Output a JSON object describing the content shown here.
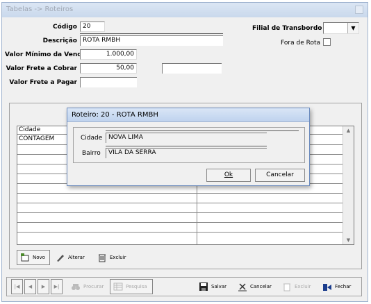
{
  "window": {
    "title": "Tabelas -> Roteiros"
  },
  "form": {
    "codigo_label": "Código",
    "codigo_value": "20",
    "descricao_label": "Descrição",
    "descricao_value": "ROTA RMBH",
    "valor_minimo_label": "Valor Mínimo da Venda",
    "valor_minimo_value": "1.000,00",
    "frete_cobrar_label": "Valor Frete a Cobrar",
    "frete_cobrar_value": "50,00",
    "frete_pagar_label": "Valor Frete a Pagar",
    "frete_pagar_value": "",
    "filial_label": "Filial de Transbordo",
    "filial_value": "",
    "fora_rota_label": "Fora de Rota"
  },
  "grid": {
    "column_cidade": "Cidade",
    "rows": [
      "CONTAGEM",
      "",
      "",
      "",
      "",
      "",
      "",
      "",
      "",
      "",
      "",
      ""
    ]
  },
  "grid_buttons": {
    "novo": "Novo",
    "alterar": "Alterar",
    "excluir": "Excluir"
  },
  "dialog": {
    "title": "Roteiro: 20 - ROTA RMBH",
    "cidade_label": "Cidade",
    "cidade_value": "NOVA LIMA",
    "bairro_label": "Bairro",
    "bairro_value": "VILA DA SERRA",
    "ok_label": "Ok",
    "cancelar_label": "Cancelar"
  },
  "toolbar": {
    "procurar": "Procurar",
    "pesquisa": "Pesquisa",
    "salvar": "Salvar",
    "cancelar": "Cancelar",
    "excluir": "Excluir",
    "fechar": "Fechar"
  }
}
